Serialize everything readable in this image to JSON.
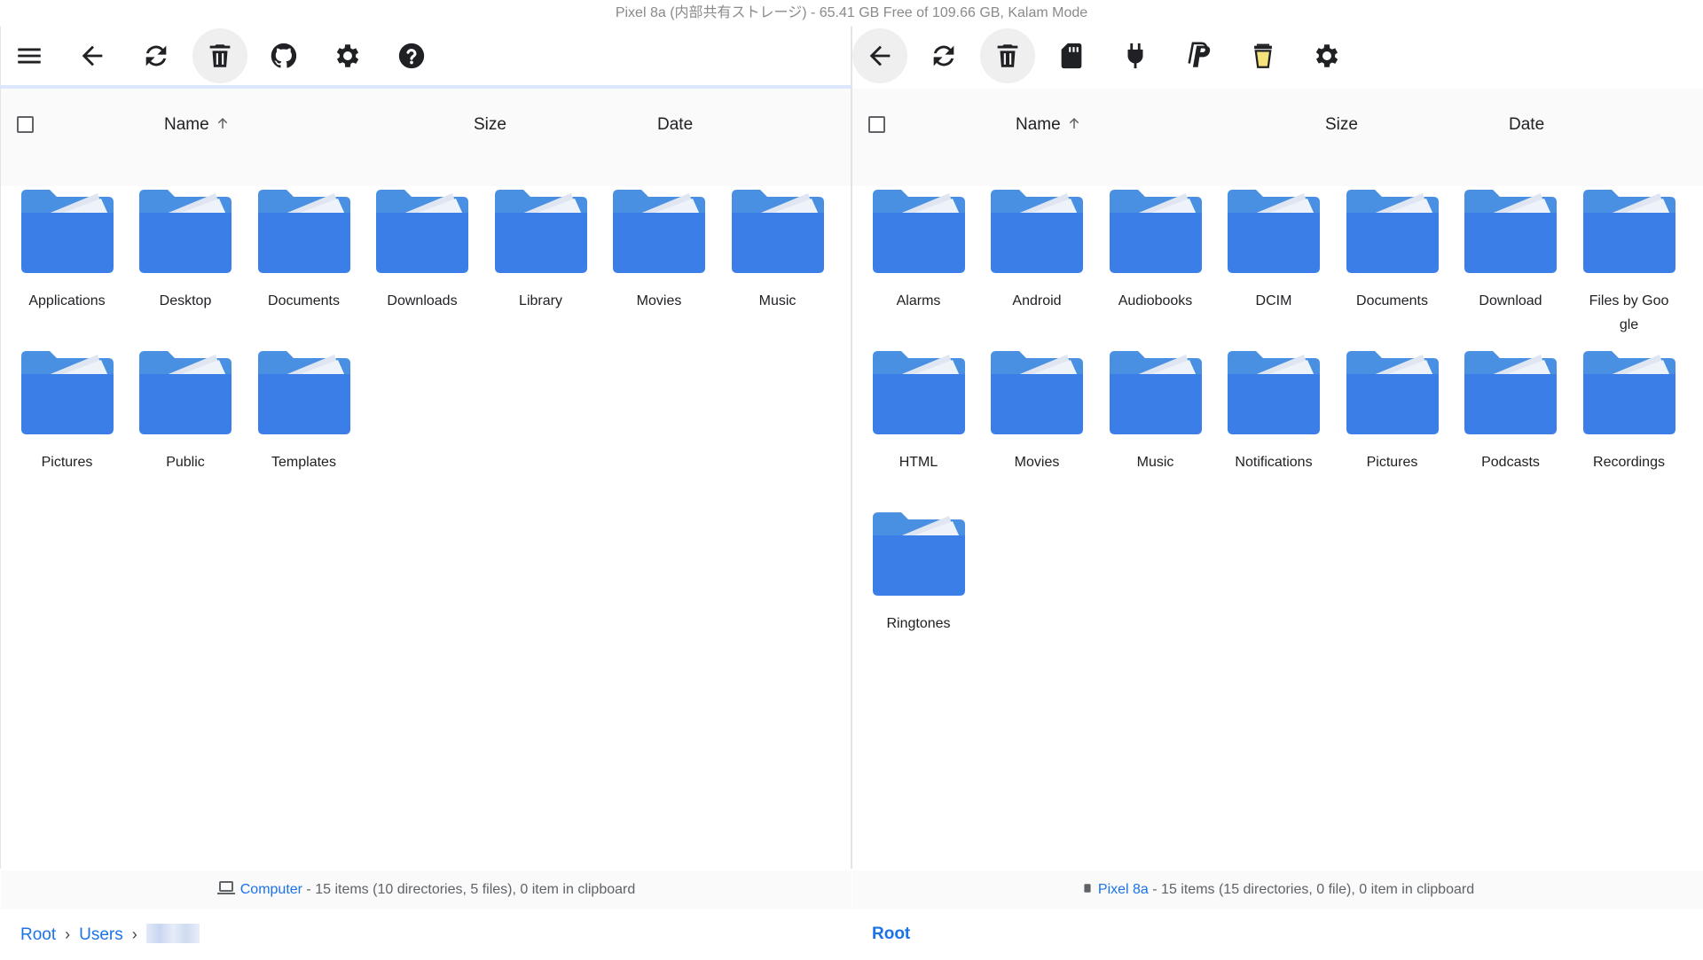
{
  "title": "Pixel 8a (内部共有ストレージ) - 65.41 GB Free of 109.66 GB, Kalam Mode",
  "colors": {
    "accent": "#1a73e8",
    "folder": "#3b7ee8",
    "folder_tab": "#4a90e2",
    "paper": "#dfe6f2"
  },
  "left": {
    "toolbar": [
      "menu-icon",
      "back-arrow-icon",
      "refresh-icon",
      "trash-icon",
      "github-icon",
      "gear-icon",
      "help-icon"
    ],
    "header": {
      "name": "Name",
      "size": "Size",
      "date": "Date"
    },
    "folders": [
      "Applications",
      "Desktop",
      "Documents",
      "Downloads",
      "Library",
      "Movies",
      "Music",
      "Pictures",
      "Public",
      "Templates"
    ],
    "status": {
      "device": "Computer",
      "text": " - 15 items (10 directories, 5 files), 0 item in clipboard"
    },
    "breadcrumbs": [
      "Root",
      "Users"
    ]
  },
  "right": {
    "toolbar": [
      "back-arrow-icon",
      "refresh-icon",
      "trash-icon",
      "sd-card-icon",
      "plug-icon",
      "paypal-icon",
      "cup-icon",
      "gear-icon"
    ],
    "header": {
      "name": "Name",
      "size": "Size",
      "date": "Date"
    },
    "folders": [
      "Alarms",
      "Android",
      "Audiobooks",
      "DCIM",
      "Documents",
      "Download",
      "Files by Goo\ngle",
      "HTML",
      "Movies",
      "Music",
      "Notifications",
      "Pictures",
      "Podcasts",
      "Recordings",
      "Ringtones"
    ],
    "status": {
      "device": "Pixel 8a",
      "text": " - 15 items (15 directories, 0 file), 0 item in clipboard"
    },
    "breadcrumbs": [
      "Root"
    ]
  }
}
